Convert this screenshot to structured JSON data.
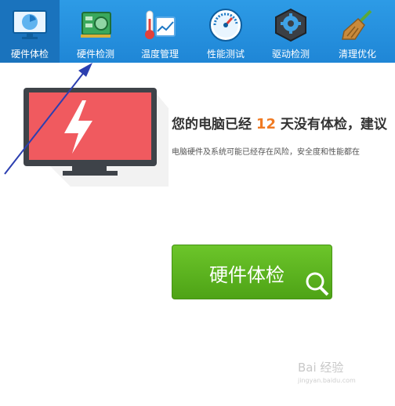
{
  "toolbar": {
    "items": [
      {
        "label": "硬件体检",
        "icon": "monitor-icon",
        "active": true
      },
      {
        "label": "硬件检测",
        "icon": "circuit-board-icon",
        "active": false
      },
      {
        "label": "温度管理",
        "icon": "thermometer-icon",
        "active": false
      },
      {
        "label": "性能测试",
        "icon": "speedometer-icon",
        "active": false
      },
      {
        "label": "驱动检测",
        "icon": "gear-cube-icon",
        "active": false
      },
      {
        "label": "清理优化",
        "icon": "broom-icon",
        "active": false
      }
    ]
  },
  "main": {
    "headline_prefix": "您的电脑已经",
    "days": "12",
    "headline_suffix": "天没有体检，建议",
    "subline": "电脑硬件及系统可能已经存在风险，安全度和性能都在",
    "cta_label": "硬件体检"
  },
  "watermark": {
    "text": "Bai 经验",
    "sub": "jingyan.baidu.com"
  },
  "colors": {
    "toolbar": "#2390e0",
    "accent_days": "#f07a22",
    "cta_green": "#5bb51f",
    "monitor_red": "#f05a5f"
  }
}
